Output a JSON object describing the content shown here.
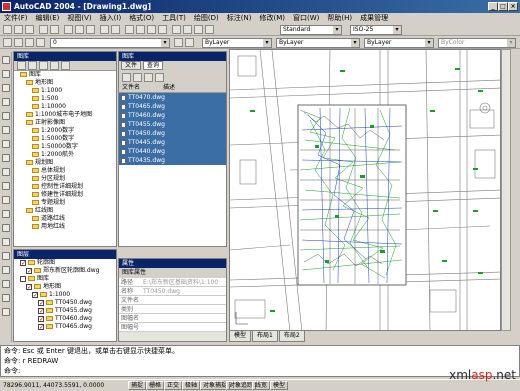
{
  "title": "AutoCAD 2004 - [Drawing1.dwg]",
  "menu": [
    "文件(F)",
    "编辑(E)",
    "视图(V)",
    "插入(I)",
    "格式(O)",
    "工具(T)",
    "绘图(D)",
    "标注(N)",
    "修改(M)",
    "窗口(W)",
    "帮助(H)",
    "成果管理"
  ],
  "toolbar": {
    "layer_value": "0",
    "style_value": "Standard",
    "dimstyle_value": "ISO-25",
    "color_value": "ByLayer",
    "linetype_value": "ByLayer",
    "lineweight_value": "ByLayer",
    "plotstyle_value": "ByColor"
  },
  "tree_panel": {
    "title": "图库",
    "items": [
      {
        "label": "图库",
        "indent": 1,
        "type": "fold"
      },
      {
        "label": "地形图",
        "indent": 2,
        "type": "fold"
      },
      {
        "label": "1:1000",
        "indent": 3,
        "type": "fold"
      },
      {
        "label": "1:500",
        "indent": 3,
        "type": "fold"
      },
      {
        "label": "1:10000",
        "indent": 3,
        "type": "fold"
      },
      {
        "label": "1:1000城市电子地图",
        "indent": 2,
        "type": "fold"
      },
      {
        "label": "正射影像图",
        "indent": 2,
        "type": "fold"
      },
      {
        "label": "1:2000数字",
        "indent": 3,
        "type": "fold"
      },
      {
        "label": "1:5000数字",
        "indent": 3,
        "type": "fold"
      },
      {
        "label": "1:50000数字",
        "indent": 3,
        "type": "fold"
      },
      {
        "label": "1:2000航外",
        "indent": 3,
        "type": "fold"
      },
      {
        "label": "规划图",
        "indent": 2,
        "type": "fold"
      },
      {
        "label": "总体规划",
        "indent": 3,
        "type": "fold"
      },
      {
        "label": "分区规划",
        "indent": 3,
        "type": "fold"
      },
      {
        "label": "控制性详细规划",
        "indent": 3,
        "type": "fold"
      },
      {
        "label": "修建性详细规划",
        "indent": 3,
        "type": "fold"
      },
      {
        "label": "专题规划",
        "indent": 3,
        "type": "fold"
      },
      {
        "label": "红线图",
        "indent": 2,
        "type": "fold"
      },
      {
        "label": "道路红线",
        "indent": 3,
        "type": "fold"
      },
      {
        "label": "用地红线",
        "indent": 3,
        "type": "fold"
      }
    ]
  },
  "file_panel": {
    "title": "图库",
    "tabs": [
      "文件",
      "查询"
    ],
    "headers": [
      "文件名",
      "描述"
    ],
    "files": [
      "TT0470.dwg",
      "TT0465.dwg",
      "TT0460.dwg",
      "TT0455.dwg",
      "TT0450.dwg",
      "TT0445.dwg",
      "TT0440.dwg",
      "TT0435.dwg"
    ]
  },
  "layer_panel": {
    "title": "图层",
    "items": [
      {
        "label": "轮廓图",
        "indent": 1,
        "check": true
      },
      {
        "label": "郑东新区轮廓图.dwg",
        "indent": 2,
        "check": true
      },
      {
        "label": "图库",
        "indent": 1,
        "check": false
      },
      {
        "label": "地形图",
        "indent": 2,
        "check": true
      },
      {
        "label": "1:1000",
        "indent": 3,
        "check": true
      },
      {
        "label": "TT0450.dwg",
        "indent": 4,
        "check": true
      },
      {
        "label": "TT0455.dwg",
        "indent": 4,
        "check": true
      },
      {
        "label": "TT0460.dwg",
        "indent": 4,
        "check": true
      },
      {
        "label": "TT0465.dwg",
        "indent": 4,
        "check": true
      }
    ]
  },
  "props_panel": {
    "title": "属性",
    "header": "图库属性",
    "rows": [
      {
        "k": "路径",
        "v": "E:\\郑东新区基础资料\\1:100"
      },
      {
        "k": "名称",
        "v": "TT0450.dwg"
      },
      {
        "k": "文件名",
        "v": ""
      },
      {
        "k": "类别",
        "v": ""
      },
      {
        "k": "图幅名",
        "v": ""
      },
      {
        "k": "图幅号",
        "v": ""
      }
    ]
  },
  "layout_tabs": [
    "模型",
    "布局1",
    "布局2"
  ],
  "command_lines": [
    "命令: Esc 或 Enter 键退出，或单击右键显示快捷菜单。",
    "命令: r REDRAW",
    "命令:"
  ],
  "status": {
    "coords": "78296.9011, 44073.5591, 0.0000",
    "toggles": [
      "捕捉",
      "栅格",
      "正交",
      "极轴",
      "对象捕捉",
      "对象追踪",
      "线宽",
      "模型"
    ]
  },
  "watermark": {
    "a": "xml",
    "b": "asp",
    "c": ".net"
  },
  "colors": {
    "selection": "#3a6ea5",
    "titlebar": "#0a246a",
    "accent": "#d8261b",
    "map_green": "#1a9e2a",
    "map_blue": "#1b3fbf"
  }
}
